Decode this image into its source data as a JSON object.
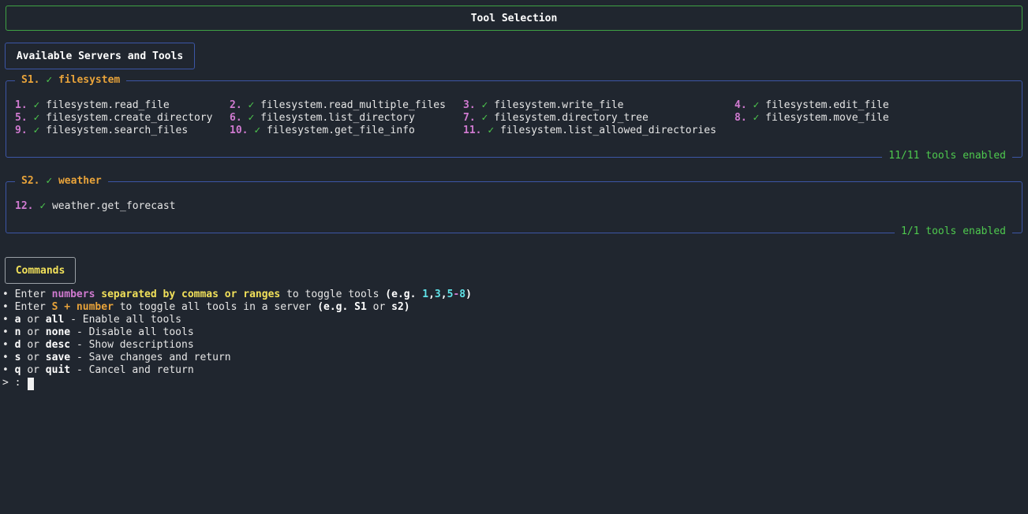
{
  "header": {
    "title": "Tool Selection"
  },
  "section_heading": "Available Servers and Tools",
  "servers": [
    {
      "id": "S1.",
      "check": "✓",
      "name": "filesystem",
      "footer": "11/11 tools enabled",
      "tools": [
        {
          "num": "1.",
          "check": "✓",
          "name": "filesystem.read_file"
        },
        {
          "num": "2.",
          "check": "✓",
          "name": "filesystem.read_multiple_files"
        },
        {
          "num": "3.",
          "check": "✓",
          "name": "filesystem.write_file"
        },
        {
          "num": "4.",
          "check": "✓",
          "name": "filesystem.edit_file"
        },
        {
          "num": "5.",
          "check": "✓",
          "name": "filesystem.create_directory"
        },
        {
          "num": "6.",
          "check": "✓",
          "name": "filesystem.list_directory"
        },
        {
          "num": "7.",
          "check": "✓",
          "name": "filesystem.directory_tree"
        },
        {
          "num": "8.",
          "check": "✓",
          "name": "filesystem.move_file"
        },
        {
          "num": "9.",
          "check": "✓",
          "name": "filesystem.search_files"
        },
        {
          "num": "10.",
          "check": "✓",
          "name": "filesystem.get_file_info"
        },
        {
          "num": "11.",
          "check": "✓",
          "name": "filesystem.list_allowed_directories"
        }
      ]
    },
    {
      "id": "S2.",
      "check": "✓",
      "name": "weather",
      "footer": "1/1 tools enabled",
      "tools": [
        {
          "num": "12.",
          "check": "✓",
          "name": "weather.get_forecast"
        }
      ]
    }
  ],
  "commands": {
    "heading": "Commands",
    "bullet": "•",
    "line1": {
      "a": "Enter",
      "b": "numbers",
      "c": "separated by commas or ranges",
      "d": "to toggle tools",
      "e": "(e.g.",
      "f": "1",
      "g": ",",
      "h": "3",
      "i": ",",
      "j": "5",
      "k": "-",
      "l": "8",
      "m": ")"
    },
    "line2": {
      "a": "Enter",
      "b": "S + number",
      "c": "to toggle all tools in a server",
      "d": "(e.g.",
      "e": "S1",
      "f": "or",
      "g": "s2",
      "h": ")"
    },
    "items": [
      {
        "key": "a",
        "or": "or",
        "alt": "all",
        "desc": "- Enable all tools"
      },
      {
        "key": "n",
        "or": "or",
        "alt": "none",
        "desc": "- Disable all tools"
      },
      {
        "key": "d",
        "or": "or",
        "alt": "desc",
        "desc": "- Show descriptions"
      },
      {
        "key": "s",
        "or": "or",
        "alt": "save",
        "desc": "- Save changes and return"
      },
      {
        "key": "q",
        "or": "or",
        "alt": "quit",
        "desc": "- Cancel and return"
      }
    ]
  },
  "prompt": {
    "text": "> :"
  },
  "colors": {
    "background": "#20262f",
    "title_border": "#3fa244",
    "panel_border": "#3c56a6",
    "server_accent": "#e8a33a",
    "check_green": "#4ec94e",
    "number_purple": "#d07ad0",
    "commands_yellow": "#f1e05a",
    "range_cyan": "#5fe3e8"
  }
}
